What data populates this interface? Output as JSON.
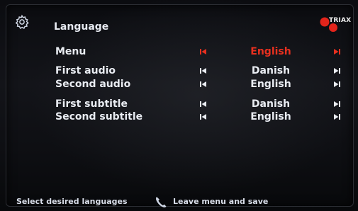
{
  "header": {
    "title": "Language",
    "logo_text": "TRIAX"
  },
  "rows": [
    {
      "label": "Menu",
      "value": "English",
      "active": true
    },
    {
      "label": "First audio",
      "value": "Danish",
      "active": false
    },
    {
      "label": "Second audio",
      "value": "English",
      "active": false
    },
    {
      "label": "First subtitle",
      "value": "Danish",
      "active": false
    },
    {
      "label": "Second subtitle",
      "value": "English",
      "active": false
    }
  ],
  "footer": {
    "hint": "Select desired languages",
    "leave_label": "Leave menu and save"
  },
  "colors": {
    "active": "#e8301f",
    "text": "#e9ecf2",
    "logo_red": "#e3241b"
  },
  "icons": {
    "settings": "gear-icon",
    "previous": "skip-previous-icon",
    "next": "skip-next-icon",
    "back": "phone-handset-icon"
  }
}
